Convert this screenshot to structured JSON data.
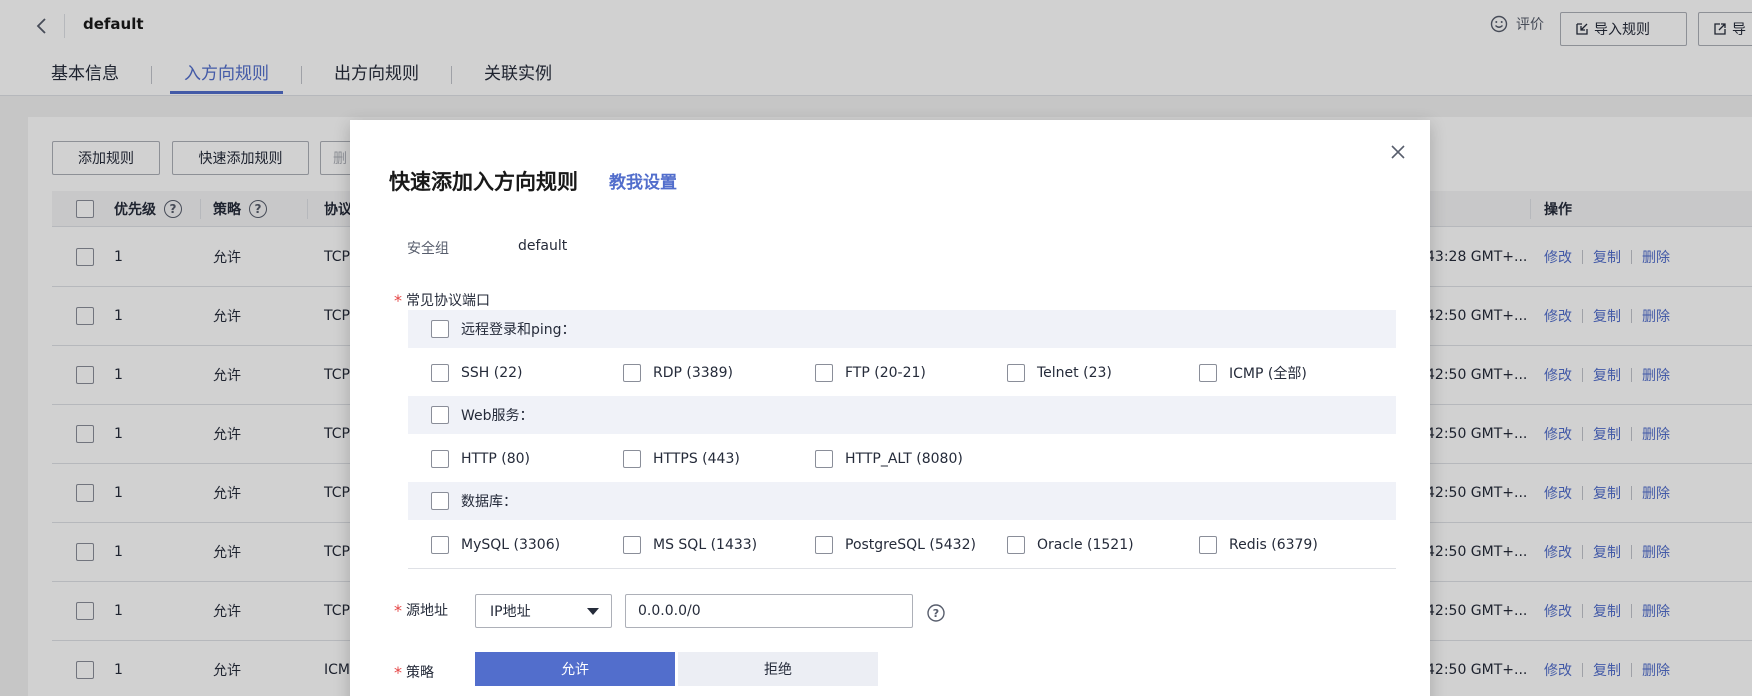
{
  "header": {
    "title": "default",
    "feedback_label": "评价",
    "import_label": "导入规则",
    "export_label": "导"
  },
  "tabs": [
    {
      "label": "基本信息",
      "active": false
    },
    {
      "label": "入方向规则",
      "active": true
    },
    {
      "label": "出方向规则",
      "active": false
    },
    {
      "label": "关联实例",
      "active": false
    }
  ],
  "toolbar": {
    "add_rule": "添加规则",
    "quick_add_rule": "快速添加规则",
    "third": "删"
  },
  "table": {
    "headers": {
      "priority": "优先级",
      "policy": "策略",
      "protocol": "协议",
      "actions": "操作"
    },
    "rows": [
      {
        "priority": "1",
        "policy": "允许",
        "protocol": "TCP",
        "time": "43:28 GMT+..."
      },
      {
        "priority": "1",
        "policy": "允许",
        "protocol": "TCP",
        "time": "42:50 GMT+..."
      },
      {
        "priority": "1",
        "policy": "允许",
        "protocol": "TCP",
        "time": "42:50 GMT+..."
      },
      {
        "priority": "1",
        "policy": "允许",
        "protocol": "TCP",
        "time": "42:50 GMT+..."
      },
      {
        "priority": "1",
        "policy": "允许",
        "protocol": "TCP",
        "time": "42:50 GMT+..."
      },
      {
        "priority": "1",
        "policy": "允许",
        "protocol": "TCP",
        "time": "42:50 GMT+..."
      },
      {
        "priority": "1",
        "policy": "允许",
        "protocol": "TCP",
        "time": "42:50 GMT+..."
      },
      {
        "priority": "1",
        "policy": "允许",
        "protocol": "ICM",
        "time": "42:50 GMT+..."
      }
    ],
    "op_modify": "修改",
    "op_copy": "复制",
    "op_delete": "删除"
  },
  "dialog": {
    "title": "快速添加入方向规则",
    "help_link": "教我设置",
    "sg_label": "安全组",
    "sg_value": "default",
    "ports_label": "常见协议端口",
    "groups": [
      {
        "label": "远程登录和ping：",
        "options": [
          "SSH (22)",
          "RDP (3389)",
          "FTP (20-21)",
          "Telnet (23)",
          "ICMP (全部)"
        ]
      },
      {
        "label": "Web服务：",
        "options": [
          "HTTP (80)",
          "HTTPS (443)",
          "HTTP_ALT (8080)"
        ]
      },
      {
        "label": "数据库：",
        "options": [
          "MySQL (3306)",
          "MS SQL (1433)",
          "PostgreSQL (5432)",
          "Oracle (1521)",
          "Redis (6379)"
        ]
      }
    ],
    "source_label": "源地址",
    "source_type": "IP地址",
    "source_value": "0.0.0.0/0",
    "policy_label": "策略",
    "policy_allow": "允许",
    "policy_deny": "拒绝"
  },
  "colors": {
    "accent": "#526ecc",
    "required": "#e54545"
  }
}
